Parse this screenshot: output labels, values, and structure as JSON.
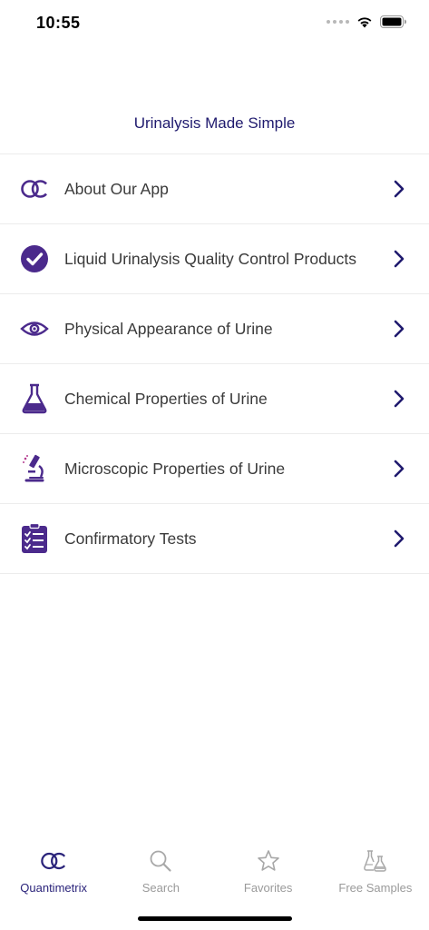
{
  "status_bar": {
    "time": "10:55"
  },
  "header": {
    "title": "Urinalysis Made Simple"
  },
  "menu": {
    "items": [
      {
        "label": "About Our App",
        "icon": "quantimetrix-logo-icon"
      },
      {
        "label": "Liquid Urinalysis Quality Control Products",
        "icon": "checkmark-circle-icon"
      },
      {
        "label": "Physical Appearance of Urine",
        "icon": "eye-icon"
      },
      {
        "label": "Chemical Properties of Urine",
        "icon": "flask-icon"
      },
      {
        "label": "Microscopic Properties of Urine",
        "icon": "microscope-icon"
      },
      {
        "label": "Confirmatory Tests",
        "icon": "clipboard-checklist-icon"
      }
    ]
  },
  "tab_bar": {
    "tabs": [
      {
        "label": "Quantimetrix",
        "icon": "quantimetrix-logo-icon",
        "active": true
      },
      {
        "label": "Search",
        "icon": "search-icon",
        "active": false
      },
      {
        "label": "Favorites",
        "icon": "star-icon",
        "active": false
      },
      {
        "label": "Free Samples",
        "icon": "lab-flasks-icon",
        "active": false
      }
    ]
  },
  "colors": {
    "accent": "#2a237a",
    "title": "#1f1a6e",
    "icon_purple": "#4b2a8c",
    "inactive": "#9a9a9a"
  }
}
